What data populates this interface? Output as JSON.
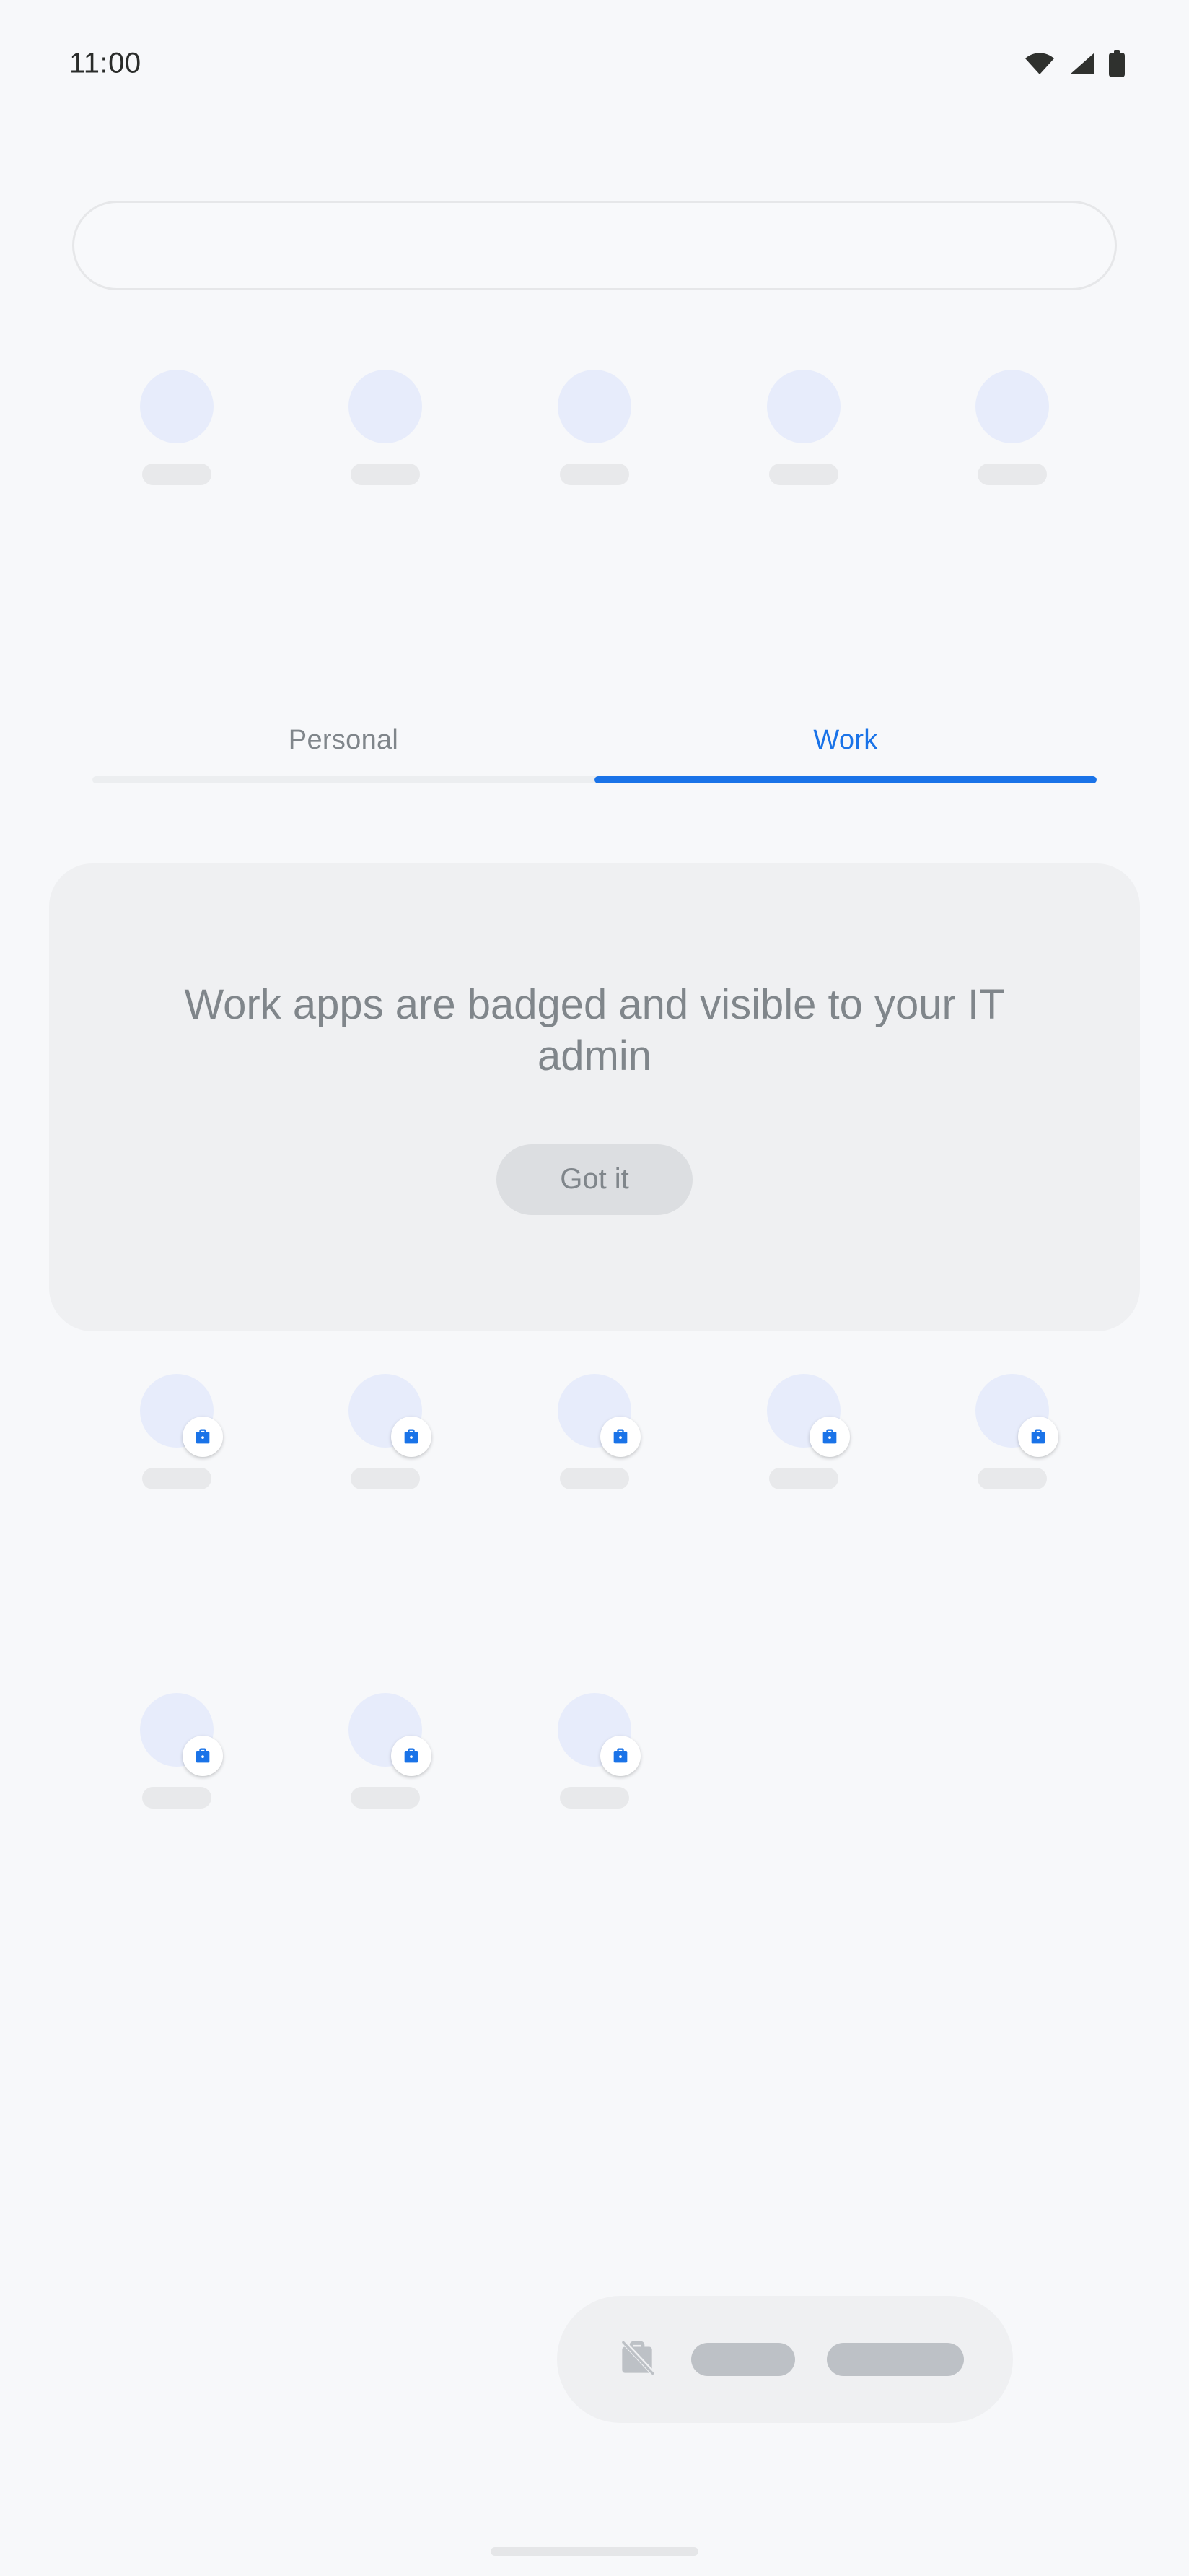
{
  "status_bar": {
    "time": "11:00",
    "icons": [
      "wifi-icon",
      "cellular-signal-icon",
      "battery-icon"
    ]
  },
  "search": {
    "value": "",
    "placeholder": ""
  },
  "personal_apps": {
    "rows": [
      [
        {
          "icon": "app-icon-placeholder",
          "label": ""
        },
        {
          "icon": "app-icon-placeholder",
          "label": ""
        },
        {
          "icon": "app-icon-placeholder",
          "label": ""
        },
        {
          "icon": "app-icon-placeholder",
          "label": ""
        },
        {
          "icon": "app-icon-placeholder",
          "label": ""
        }
      ]
    ]
  },
  "tabs": {
    "items": [
      {
        "id": "personal",
        "label": "Personal",
        "active": false
      },
      {
        "id": "work",
        "label": "Work",
        "active": true
      }
    ],
    "active_color": "#1a73e8",
    "inactive_color": "#80868b"
  },
  "info_card": {
    "message": "Work apps are badged and visible to your IT admin",
    "button_label": "Got it",
    "background": "#eff0f2"
  },
  "work_apps": {
    "badge_icon": "briefcase-icon",
    "badge_color": "#1a73e8",
    "rows": [
      [
        {
          "icon": "app-icon-placeholder",
          "label": "",
          "badged": true
        },
        {
          "icon": "app-icon-placeholder",
          "label": "",
          "badged": true
        },
        {
          "icon": "app-icon-placeholder",
          "label": "",
          "badged": true
        },
        {
          "icon": "app-icon-placeholder",
          "label": "",
          "badged": true
        },
        {
          "icon": "app-icon-placeholder",
          "label": "",
          "badged": true
        }
      ],
      [
        {
          "icon": "app-icon-placeholder",
          "label": "",
          "badged": true
        },
        {
          "icon": "app-icon-placeholder",
          "label": "",
          "badged": true
        },
        {
          "icon": "app-icon-placeholder",
          "label": "",
          "badged": true
        }
      ]
    ]
  },
  "work_toggle_bar": {
    "icon": "briefcase-off-icon",
    "placeholders": 2
  },
  "gesture_nav": {
    "handle": "home-gesture-handle"
  }
}
